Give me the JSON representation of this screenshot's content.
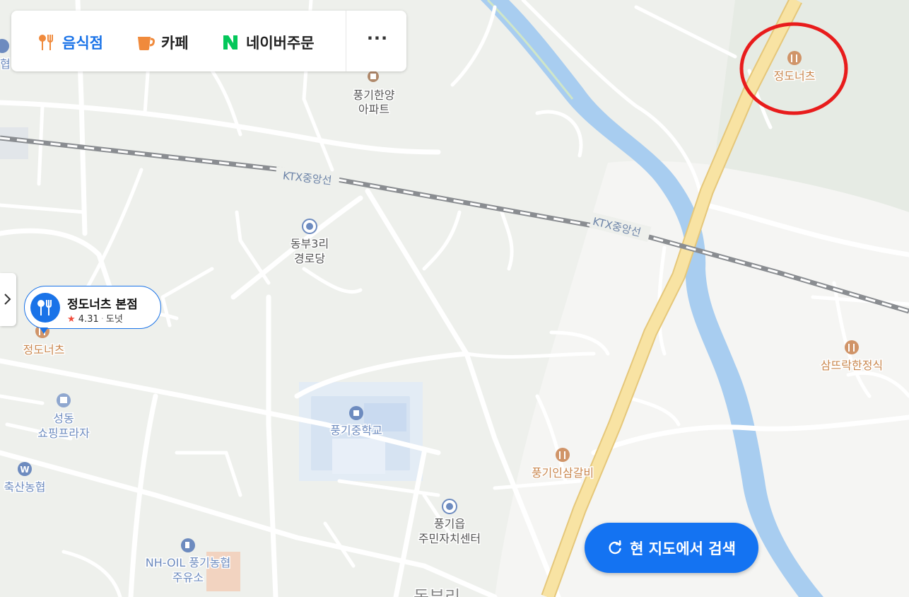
{
  "categories": [
    {
      "label": "음식점",
      "icon": "restaurant-icon",
      "color": "#1a73e8"
    },
    {
      "label": "카페",
      "icon": "cafe-icon",
      "color": "#222222"
    },
    {
      "label": "네이버주문",
      "icon": "naver-n-icon",
      "color": "#222222"
    }
  ],
  "more_label": "···",
  "selected_place": {
    "name": "정도너츠 본점",
    "rating": "4.31",
    "category": "도넛"
  },
  "search_button_label": "현 지도에서 검색",
  "map": {
    "rail_labels": [
      "KTX중앙선",
      "KTX중앙선"
    ],
    "pois": {
      "apartment": [
        "풍기한양",
        "아파트"
      ],
      "senior_center": [
        "동부3리",
        "경로당"
      ],
      "donut_left": "정도너츠",
      "donut_right": "정도너츠",
      "plaza": [
        "성동",
        "쇼핑프라자"
      ],
      "bank": "축산농협",
      "school": "풍기중학교",
      "hanjeongsik": "삼뜨락한정식",
      "galbi": "풍기인삼갈비",
      "community_center": [
        "풍기읍",
        "주민자치센터"
      ],
      "gas_station": [
        "NH-OIL 풍기농협",
        "주유소"
      ],
      "top_left_partial": "협",
      "bottom_partial": "동부리"
    }
  },
  "colors": {
    "map_bg": "#eef0ec",
    "river": "#a8cdf0",
    "highway": "#f6de9a",
    "poi_food": "#c9874e",
    "poi_public": "#6d8bbf",
    "highlight_circle": "#e81c1c",
    "accent": "#1473f2"
  }
}
